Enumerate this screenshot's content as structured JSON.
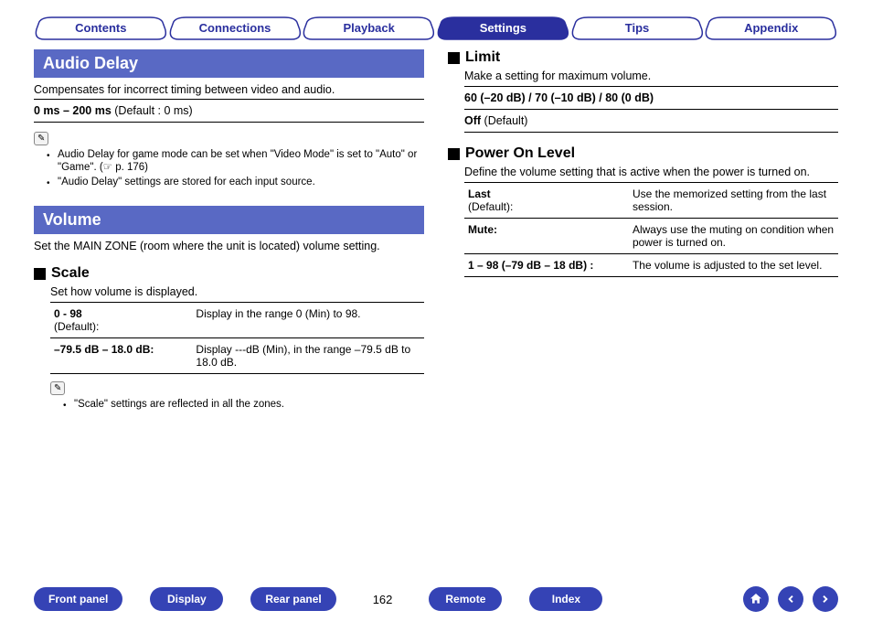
{
  "tabs": {
    "contents": "Contents",
    "connections": "Connections",
    "playback": "Playback",
    "settings": "Settings",
    "tips": "Tips",
    "appendix": "Appendix",
    "active": "settings"
  },
  "left": {
    "audio_delay": {
      "title": "Audio Delay",
      "desc": "Compensates for incorrect timing between video and audio.",
      "range_bold": "0 ms – 200 ms",
      "range_rest": " (Default : 0 ms)",
      "notes": [
        "Audio Delay for game mode can be set when \"Video Mode\" is set to \"Auto\" or \"Game\".  (☞ p. 176)",
        "\"Audio Delay\" settings are stored for each input source."
      ],
      "page_link_text": "p. 176"
    },
    "volume": {
      "title": "Volume",
      "desc": "Set the MAIN ZONE (room where the unit is located) volume setting.",
      "scale": {
        "heading": "Scale",
        "desc": "Set how volume is displayed.",
        "rows": [
          {
            "k": "0 - 98",
            "k_sub": "(Default):",
            "v": "Display in the range 0 (Min) to 98."
          },
          {
            "k": "–79.5 dB – 18.0 dB:",
            "k_sub": "",
            "v": "Display ---dB (Min), in the range –79.5 dB to 18.0 dB."
          }
        ],
        "notes": [
          "\"Scale\" settings are reflected in all the zones."
        ]
      }
    }
  },
  "right": {
    "limit": {
      "heading": "Limit",
      "desc": "Make a setting for maximum volume.",
      "line1": "60 (–20 dB) / 70 (–10 dB) / 80 (0 dB)",
      "line2_bold": "Off",
      "line2_rest": " (Default)"
    },
    "power_on": {
      "heading": "Power On Level",
      "desc": "Define the volume setting that is active when the power is turned on.",
      "rows": [
        {
          "k": "Last",
          "k_sub": "(Default):",
          "v": "Use the memorized setting from the last session."
        },
        {
          "k": "Mute:",
          "k_sub": "",
          "v": "Always use the muting on condition when power is turned on."
        },
        {
          "k": "1 – 98 (–79 dB – 18 dB) :",
          "k_sub": "",
          "v": "The volume is adjusted to the set level."
        }
      ]
    }
  },
  "bottom": {
    "front_panel": "Front panel",
    "display": "Display",
    "rear_panel": "Rear panel",
    "page": "162",
    "remote": "Remote",
    "index": "Index"
  }
}
